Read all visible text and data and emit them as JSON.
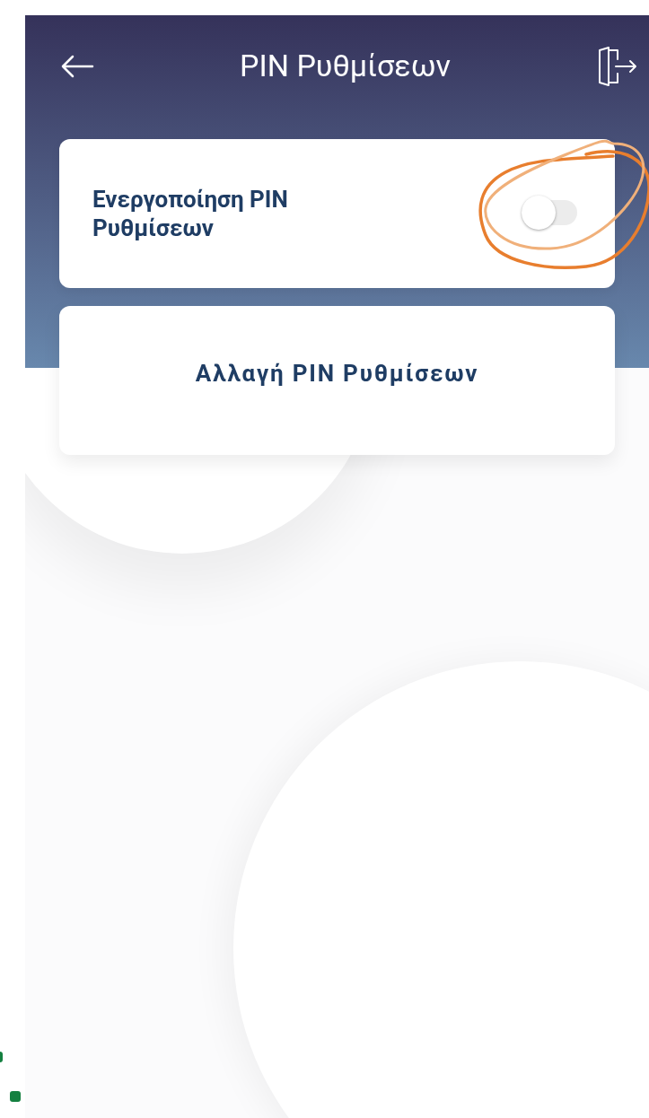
{
  "header": {
    "title": "PIN Ρυθμίσεων"
  },
  "pin_toggle": {
    "label": "Ενεργοποίηση PIN Ρυθμίσεων",
    "on": false
  },
  "change_pin_button": {
    "label": "Αλλαγή PIN Ρυθμίσεων"
  }
}
